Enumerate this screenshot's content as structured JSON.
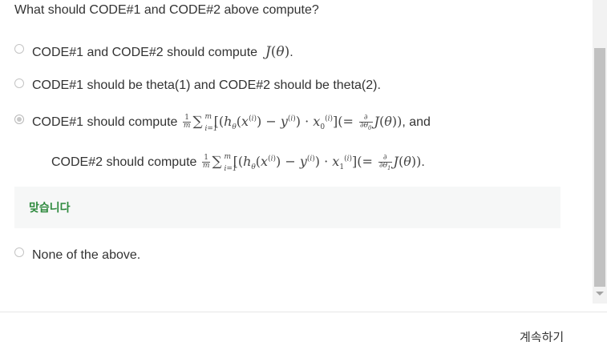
{
  "question": "What should CODE#1 and CODE#2 above compute?",
  "options": [
    {
      "prefix": "CODE#1 and CODE#2 should compute",
      "suffix": ".",
      "selected": false
    },
    {
      "text": "CODE#1 should be theta(1) and CODE#2 should be theta(2).",
      "selected": false
    },
    {
      "line1_prefix": "CODE#1 should compute",
      "line1_suffix": ", and",
      "line2_prefix": "CODE#2 should compute",
      "line2_suffix": ".",
      "selected": true
    },
    {
      "text": "None of the above.",
      "selected": false
    }
  ],
  "feedback": {
    "text": "맞습니다",
    "color": "#2e8a3e"
  },
  "footer": {
    "continue_label": "계속하기"
  }
}
